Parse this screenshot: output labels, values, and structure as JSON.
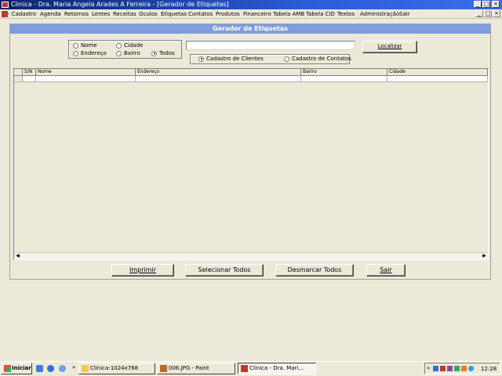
{
  "window": {
    "title": "Clinica - Dra. Maria Angela Arades A Ferreira - [Gerador de Etiquetas]",
    "min_glyph": "_",
    "max_glyph": "□",
    "close_glyph": "×"
  },
  "menu": {
    "items": [
      "- Cadastro",
      "Agenda",
      "Retornos",
      "Lentes",
      "Receitas",
      "Oculos",
      "Etiquetas",
      "Contatos",
      "Produtos",
      "Financeiro",
      "Tabela AMB",
      "Tabela CID",
      "Textos",
      "Administração",
      "Sair"
    ]
  },
  "panel": {
    "title": "Gerador de Etiquetas"
  },
  "filter": {
    "options": [
      {
        "label": "Nome",
        "selected": false
      },
      {
        "label": "Cidade",
        "selected": false
      },
      {
        "label": "Endereço",
        "selected": false
      },
      {
        "label": "Bairro",
        "selected": false
      },
      {
        "label": "Todos",
        "selected": true
      }
    ]
  },
  "search": {
    "value": "",
    "button_label": "Localizar"
  },
  "source": {
    "options": [
      {
        "label": "Cadastro de Clientes",
        "selected": true
      },
      {
        "label": "Cadastro de Contatos",
        "selected": false
      }
    ]
  },
  "grid": {
    "columns": [
      "S/N",
      "Nome",
      "Endereço",
      "Bairro",
      "Cidade"
    ],
    "rows": []
  },
  "actions": {
    "print_label": "Imprimir",
    "select_all_label": "Selecionar Todos",
    "deselect_all_label": "Desmarcar Todos",
    "exit_label": "Sair"
  },
  "taskbar": {
    "start_label": "Iniciar",
    "tasks": [
      {
        "label": "Clinica-1024x768",
        "active": false
      },
      {
        "label": "006.JPG - Paint",
        "active": false
      },
      {
        "label": "Clinica - Dra. Mari...",
        "active": true
      }
    ],
    "clock": "12:28"
  }
}
